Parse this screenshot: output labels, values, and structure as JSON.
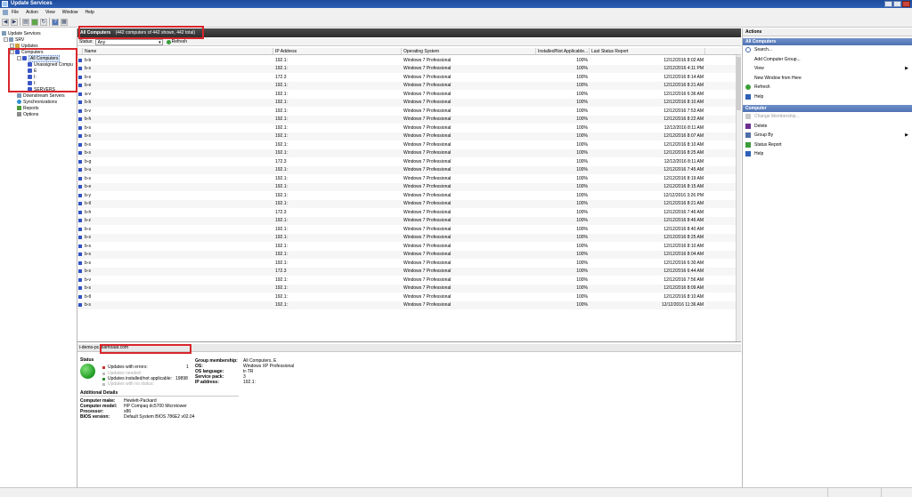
{
  "window": {
    "title": "Update Services"
  },
  "menu": [
    "File",
    "Action",
    "View",
    "Window",
    "Help"
  ],
  "tree": {
    "root": "Update Services",
    "server": "SRV",
    "updates": "Updates",
    "computers": "Computers",
    "all_computers": "All Computers",
    "unassigned": "Unassigned Compu",
    "group1": "E",
    "group2": "I:",
    "group3": "I:",
    "servers": "SERVERS",
    "downstream": "Downstream Servers",
    "synchronizations": "Synchronizations",
    "reports": "Reports",
    "options": "Options"
  },
  "header": {
    "title": "All Computers",
    "count": "(442 computers of 442 shown, 442 total)"
  },
  "filter": {
    "label": "Status:",
    "value": "Any",
    "refresh": "Refresh"
  },
  "columns": {
    "name": "Name",
    "ip": "IP Address",
    "os": "Operating System",
    "installed": "Installed/Not Applicable...",
    "last": "Last Status Report"
  },
  "rows": [
    {
      "name": "b-b",
      "ip": "192.1:",
      "os": "Windows 7 Professional",
      "installed": "100%",
      "last": "12/12/2016 8:02 AM"
    },
    {
      "name": "b-s",
      "ip": "192.1:",
      "os": "Windows 7 Professional",
      "installed": "100%",
      "last": "12/12/2016 4:11 PM"
    },
    {
      "name": "b-s",
      "ip": "172.3",
      "os": "Windows 7 Professional",
      "installed": "100%",
      "last": "12/12/2016 8:14 AM"
    },
    {
      "name": "b-e",
      "ip": "192.1:",
      "os": "Windows 7 Professional",
      "installed": "100%",
      "last": "12/12/2016 8:21 AM"
    },
    {
      "name": "a-v",
      "ip": "192.1:",
      "os": "Windows 7 Professional",
      "installed": "100%",
      "last": "12/12/2016 6:36 AM"
    },
    {
      "name": "b-b",
      "ip": "192.1:",
      "os": "Windows 7 Professional",
      "installed": "100%",
      "last": "12/12/2016 8:10 AM"
    },
    {
      "name": "b-v",
      "ip": "192.1:",
      "os": "Windows 7 Professional",
      "installed": "100%",
      "last": "12/12/2016 7:53 AM"
    },
    {
      "name": "b-h",
      "ip": "192.1:",
      "os": "Windows 7 Professional",
      "installed": "100%",
      "last": "12/12/2016 8:22 AM"
    },
    {
      "name": "b-s",
      "ip": "192.1:",
      "os": "Windows 7 Professional",
      "installed": "100%",
      "last": "12/12/2016 8:11 AM"
    },
    {
      "name": "b-s",
      "ip": "192.1:",
      "os": "Windows 7 Professional",
      "installed": "100%",
      "last": "12/12/2016 8:07 AM"
    },
    {
      "name": "b-s",
      "ip": "192.1:",
      "os": "Windows 7 Professional",
      "installed": "100%",
      "last": "12/12/2016 8:10 AM"
    },
    {
      "name": "b-s",
      "ip": "192.1:",
      "os": "Windows 7 Professional",
      "installed": "100%",
      "last": "12/12/2016 8:25 AM"
    },
    {
      "name": "b-g",
      "ip": "172.3",
      "os": "Windows 7 Professional",
      "installed": "100%",
      "last": "12/12/2016 8:11 AM"
    },
    {
      "name": "b-u",
      "ip": "192.1:",
      "os": "Windows 7 Professional",
      "installed": "100%",
      "last": "12/12/2016 7:45 AM"
    },
    {
      "name": "b-s",
      "ip": "192.1:",
      "os": "Windows 7 Professional",
      "installed": "100%",
      "last": "12/12/2016 8:19 AM"
    },
    {
      "name": "b-e",
      "ip": "192.1:",
      "os": "Windows 7 Professional",
      "installed": "100%",
      "last": "12/12/2016 8:15 AM"
    },
    {
      "name": "b-y",
      "ip": "192.1:",
      "os": "Windows 7 Professional",
      "installed": "100%",
      "last": "12/12/2016 3:26 PM"
    },
    {
      "name": "b-tl",
      "ip": "192.1:",
      "os": "Windows 7 Professional",
      "installed": "100%",
      "last": "12/12/2016 8:21 AM"
    },
    {
      "name": "b-h",
      "ip": "172.3",
      "os": "Windows 7 Professional",
      "installed": "100%",
      "last": "12/12/2016 7:46 AM"
    },
    {
      "name": "b-z",
      "ip": "192.1:",
      "os": "Windows 7 Professional",
      "installed": "100%",
      "last": "12/12/2016 8:46 AM"
    },
    {
      "name": "b-s",
      "ip": "192.1:",
      "os": "Windows 7 Professional",
      "installed": "100%",
      "last": "12/12/2016 8:40 AM"
    },
    {
      "name": "b-s",
      "ip": "192.1:",
      "os": "Windows 7 Professional",
      "installed": "100%",
      "last": "12/12/2016 8:25 AM"
    },
    {
      "name": "b-s",
      "ip": "192.1:",
      "os": "Windows 7 Professional",
      "installed": "100%",
      "last": "12/12/2016 8:10 AM"
    },
    {
      "name": "b-s",
      "ip": "192.1:",
      "os": "Windows 7 Professional",
      "installed": "100%",
      "last": "12/12/2016 8:04 AM"
    },
    {
      "name": "b-s",
      "ip": "192.1:",
      "os": "Windows 7 Professional",
      "installed": "100%",
      "last": "12/12/2016 6:30 AM"
    },
    {
      "name": "b-s",
      "ip": "172.3",
      "os": "Windows 7 Professional",
      "installed": "100%",
      "last": "12/12/2016 6:44 AM"
    },
    {
      "name": "b-v",
      "ip": "192.1:",
      "os": "Windows 7 Professional",
      "installed": "100%",
      "last": "12/12/2016 7:56 AM"
    },
    {
      "name": "b-s",
      "ip": "192.1:",
      "os": "Windows 7 Professional",
      "installed": "100%",
      "last": "12/12/2016 8:09 AM"
    },
    {
      "name": "b-tl",
      "ip": "192.1:",
      "os": "Windows 7 Professional",
      "installed": "100%",
      "last": "12/12/2016 8:10 AM"
    },
    {
      "name": "b-s",
      "ip": "192.1:",
      "os": "Windows 7 Professional",
      "installed": "100%",
      "last": "12/12/2016 11:36 AM"
    }
  ],
  "detail": {
    "fqdn": "i-demo-pc.diamoaat.com",
    "status_title": "Status",
    "errors_label": "Updates with errors:",
    "errors_value": "1",
    "needed_label": "Updates needed:",
    "installed_label": "Updates installed/not applicable:",
    "installed_value": "19898",
    "unknown_label": "Updates with no status:",
    "group_label": "Group membership:",
    "group_value": "All Computers, E",
    "os_label": "OS:",
    "os_value": "Windows XP Professional",
    "lang_label": "OS language:",
    "lang_value": "tr-TR",
    "sp_label": "Service pack:",
    "sp_value": "3",
    "ip_label": "IP address:",
    "ip_value": "192.1:",
    "additional_title": "Additional Details",
    "make_label": "Computer make:",
    "make_value": "Hewlett-Packard",
    "model_label": "Computer model:",
    "model_value": "HP Compaq dc5700 Microtower",
    "proc_label": "Processor:",
    "proc_value": "x86",
    "bios_label": "BIOS version:",
    "bios_value": "Default System BIOS 786E2 v02.04"
  },
  "actions": {
    "title": "Actions",
    "section1": "All Computers",
    "search": "Search...",
    "add_group": "Add Computer Group...",
    "view": "View",
    "new_window": "New Window from Here",
    "refresh": "Refresh",
    "help1": "Help",
    "section2": "Computer",
    "change_membership": "Change Membership...",
    "delete": "Delete",
    "group_by": "Group By",
    "status_report": "Status Report",
    "help2": "Help"
  },
  "colors": {
    "highlight": "#d8262c",
    "section_blue": "#4f72b3"
  }
}
